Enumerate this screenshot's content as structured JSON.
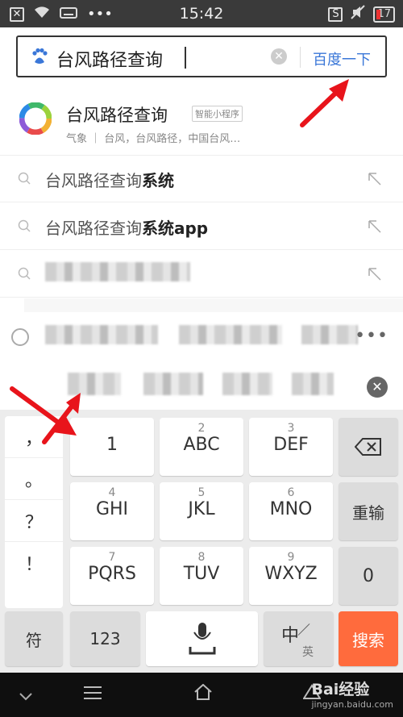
{
  "status": {
    "time": "15:42",
    "battery": "17"
  },
  "search": {
    "query": "台风路径查询",
    "button": "百度一下"
  },
  "app_suggestion": {
    "name": "台风路径查询",
    "badge": "智能小程序",
    "meta": "气象 ｜ 台风，台风路径，中国台风…"
  },
  "suggestions": [
    {
      "prefix": "台风路径查询",
      "bold": "系统"
    },
    {
      "prefix": "台风路径查询",
      "bold": "系统app"
    }
  ],
  "keyboard": {
    "punct": [
      "，",
      "。",
      "？",
      "！"
    ],
    "rows": [
      [
        {
          "sub": "",
          "main": "1"
        },
        {
          "sub": "2",
          "main": "ABC"
        },
        {
          "sub": "3",
          "main": "DEF"
        }
      ],
      [
        {
          "sub": "4",
          "main": "GHI"
        },
        {
          "sub": "5",
          "main": "JKL"
        },
        {
          "sub": "6",
          "main": "MNO"
        }
      ],
      [
        {
          "sub": "7",
          "main": "PQRS"
        },
        {
          "sub": "8",
          "main": "TUV"
        },
        {
          "sub": "9",
          "main": "WXYZ"
        }
      ]
    ],
    "retype": "重输",
    "zero": "0",
    "symbols": "符",
    "numbers": "123",
    "lang_main": "中",
    "lang_sub": "英",
    "search": "搜索"
  },
  "watermark": {
    "brand": "Bai经验",
    "url": "jingyan.baidu.com"
  },
  "colors": {
    "accent": "#3a77d8",
    "search_key": "#ff6b3d",
    "arrow": "#e8141b"
  }
}
